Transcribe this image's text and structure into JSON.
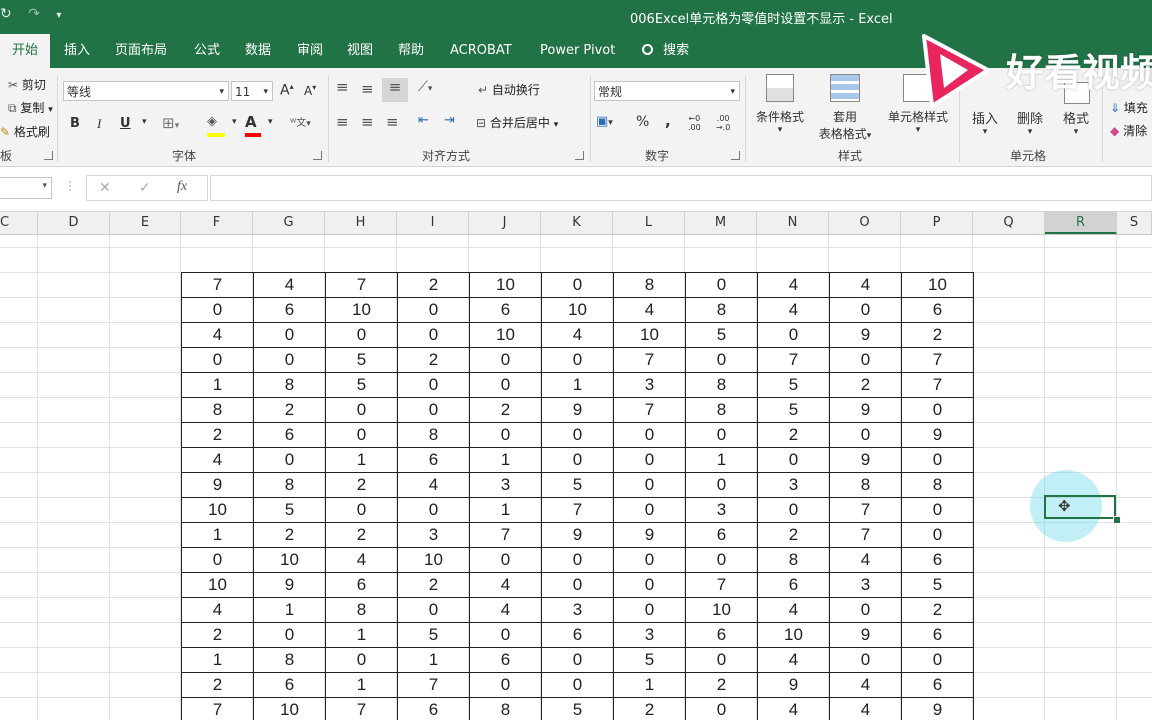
{
  "window": {
    "title": "006Excel单元格为零值时设置不显示  -  Excel",
    "qat_icons": [
      "redo-icon",
      "undo-icon",
      "customize-qat-icon"
    ]
  },
  "tabs": [
    {
      "label": "开始",
      "active": true
    },
    {
      "label": "插入"
    },
    {
      "label": "页面布局"
    },
    {
      "label": "公式"
    },
    {
      "label": "数据"
    },
    {
      "label": "审阅"
    },
    {
      "label": "视图"
    },
    {
      "label": "帮助"
    },
    {
      "label": "ACROBAT"
    },
    {
      "label": "Power Pivot"
    }
  ],
  "tell_me": "搜索",
  "ribbon": {
    "clipboard": {
      "cut": "剪切",
      "copy": "复制",
      "format_painter": "格式刷",
      "label": "板"
    },
    "font": {
      "name": "等线",
      "size": "11",
      "label": "字体",
      "bold": "B",
      "italic": "I",
      "underline": "U",
      "grow": "A",
      "shrink": "A",
      "color_letter": "A",
      "phonetic": "ᵂ文"
    },
    "alignment": {
      "wrap": "自动换行",
      "merge": "合并后居中",
      "label": "对齐方式"
    },
    "number": {
      "format": "常规",
      "percent": "%",
      "comma": ",",
      "inc_dec": ".00",
      "label": "数字"
    },
    "styles": {
      "conditional": "条件格式",
      "table": "套用\n表格格式",
      "table_line1": "套用",
      "table_line2": "表格格式",
      "cell_styles": "单元格样式",
      "label": "样式"
    },
    "cells": {
      "insert": "插入",
      "delete": "删除",
      "format": "格式",
      "label": "单元格"
    },
    "editing": {
      "fill": "填充",
      "clear": "清除"
    }
  },
  "formula_bar": {
    "fx": "fx",
    "cancel": "✕",
    "enter": "✓",
    "value": ""
  },
  "columns": [
    "C",
    "D",
    "E",
    "F",
    "G",
    "H",
    "I",
    "J",
    "K",
    "L",
    "M",
    "N",
    "O",
    "P",
    "Q",
    "R",
    "S"
  ],
  "selected_column": "R",
  "table": [
    [
      7,
      4,
      7,
      2,
      10,
      0,
      8,
      0,
      4,
      4,
      10
    ],
    [
      0,
      6,
      10,
      0,
      6,
      10,
      4,
      8,
      4,
      0,
      6
    ],
    [
      4,
      0,
      0,
      0,
      10,
      4,
      10,
      5,
      0,
      9,
      2
    ],
    [
      0,
      0,
      5,
      2,
      0,
      0,
      7,
      0,
      7,
      0,
      7
    ],
    [
      1,
      8,
      5,
      0,
      0,
      1,
      3,
      8,
      5,
      2,
      7
    ],
    [
      8,
      2,
      0,
      0,
      2,
      9,
      7,
      8,
      5,
      9,
      0
    ],
    [
      2,
      6,
      0,
      8,
      0,
      0,
      0,
      0,
      2,
      0,
      9
    ],
    [
      4,
      0,
      1,
      6,
      1,
      0,
      0,
      1,
      0,
      9,
      0
    ],
    [
      9,
      8,
      2,
      4,
      3,
      5,
      0,
      0,
      3,
      8,
      8
    ],
    [
      10,
      5,
      0,
      0,
      1,
      7,
      0,
      3,
      0,
      7,
      0
    ],
    [
      1,
      2,
      2,
      3,
      7,
      9,
      9,
      6,
      2,
      7,
      0
    ],
    [
      0,
      10,
      4,
      10,
      0,
      0,
      0,
      0,
      8,
      4,
      6
    ],
    [
      10,
      9,
      6,
      2,
      4,
      0,
      0,
      7,
      6,
      3,
      5
    ],
    [
      4,
      1,
      8,
      0,
      4,
      3,
      0,
      10,
      4,
      0,
      2
    ],
    [
      2,
      0,
      1,
      5,
      0,
      6,
      3,
      6,
      10,
      9,
      6
    ],
    [
      1,
      8,
      0,
      1,
      6,
      0,
      5,
      0,
      4,
      0,
      0
    ],
    [
      2,
      6,
      1,
      7,
      0,
      0,
      1,
      2,
      9,
      4,
      6
    ],
    [
      7,
      10,
      7,
      6,
      8,
      5,
      2,
      0,
      4,
      4,
      9
    ]
  ],
  "watermark": {
    "text": "好看视频",
    "color": "#ffffff"
  },
  "colors": {
    "excel_green": "#217346",
    "accent_pink": "#e8265d"
  }
}
